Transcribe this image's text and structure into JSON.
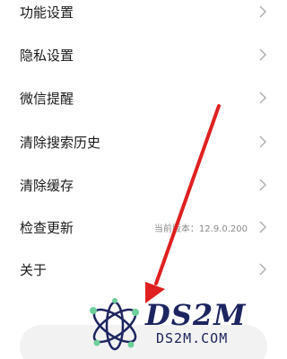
{
  "menu": {
    "items": [
      {
        "label": "功能设置",
        "value": ""
      },
      {
        "label": "隐私设置",
        "value": ""
      },
      {
        "label": "微信提醒",
        "value": ""
      },
      {
        "label": "清除搜索历史",
        "value": ""
      },
      {
        "label": "清除缓存",
        "value": ""
      },
      {
        "label": "检查更新",
        "value": "当前版本：12.9.0.200"
      },
      {
        "label": "关于",
        "value": ""
      }
    ]
  },
  "icons": {
    "chevron": "chevron-right-icon",
    "logo": "atom-logo-icon"
  },
  "annotation": {
    "arrow_color": "#e02020"
  },
  "watermark": {
    "brand": "DS2M",
    "domain": "DS2M.COM"
  },
  "colors": {
    "text": "#1a1a1a",
    "secondary_text": "#8a8a8a",
    "chevron": "#b0b0b0",
    "watermark": "#1d2560"
  }
}
